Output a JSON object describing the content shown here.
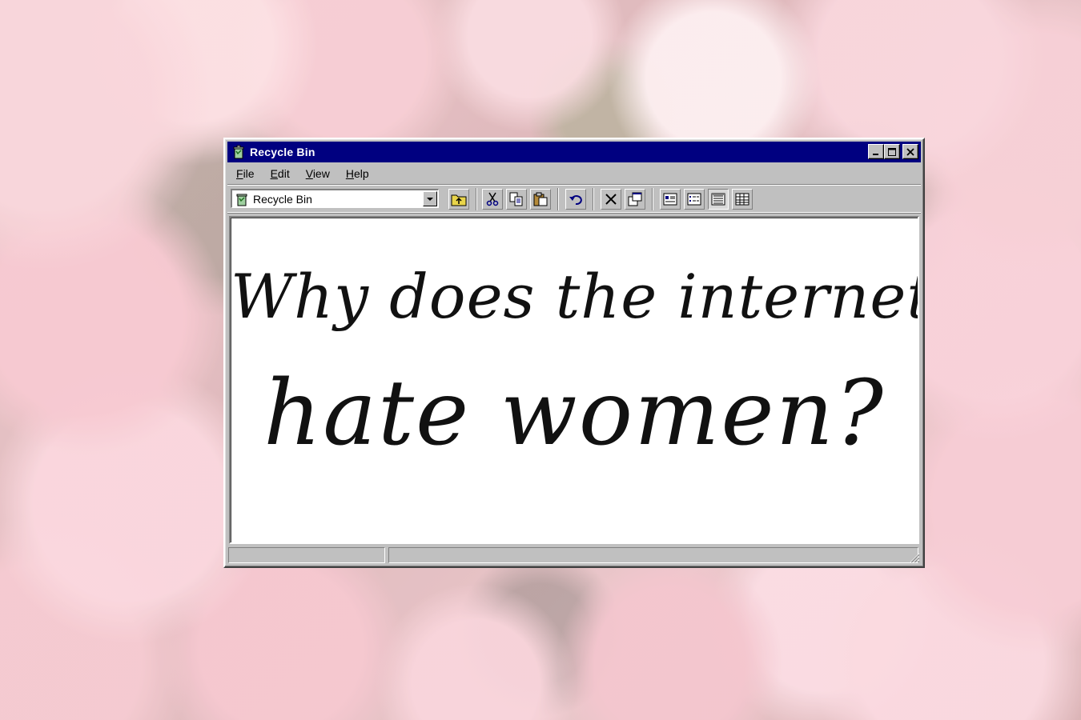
{
  "window": {
    "title": "Recycle Bin",
    "title_icon": "recycle-bin-icon"
  },
  "menu": {
    "items": [
      {
        "label": "File",
        "accel": "F",
        "rest": "ile"
      },
      {
        "label": "Edit",
        "accel": "E",
        "rest": "dit"
      },
      {
        "label": "View",
        "accel": "V",
        "rest": "iew"
      },
      {
        "label": "Help",
        "accel": "H",
        "rest": "elp"
      }
    ]
  },
  "toolbar": {
    "address_value": "Recycle Bin",
    "tools": [
      "up-folder-icon",
      "cut-icon",
      "copy-icon",
      "paste-icon",
      "undo-icon",
      "delete-icon",
      "properties-icon",
      "large-icons-view-icon",
      "small-icons-view-icon",
      "list-view-icon",
      "details-view-icon"
    ]
  },
  "content": {
    "line1": "Why does the internet",
    "line2": "hate women?"
  },
  "status": {
    "left": "",
    "right": ""
  },
  "colors": {
    "titlebar": "#000080",
    "face": "#c0c0c0",
    "content_bg": "#ffffff",
    "text": "#111111"
  }
}
